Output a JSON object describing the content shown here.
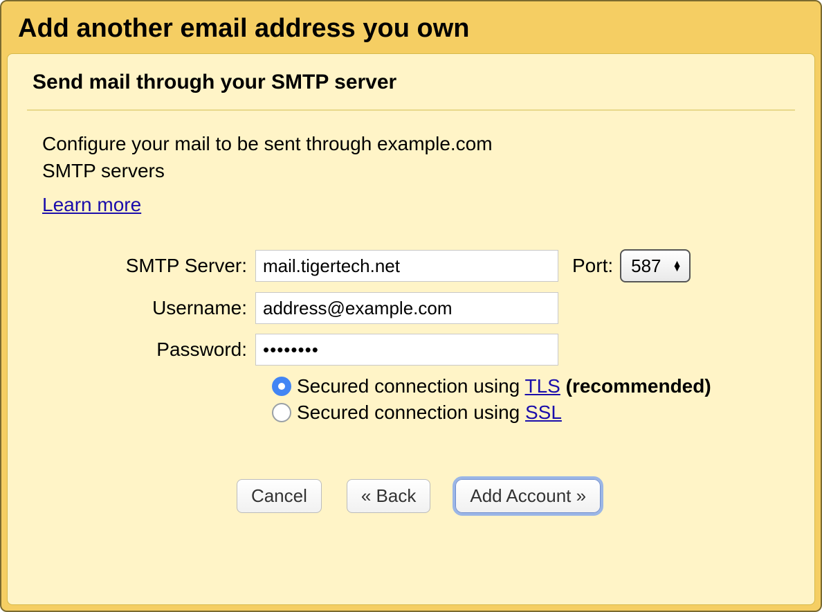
{
  "titlebar": {
    "title": "Add another email address you own"
  },
  "panel": {
    "heading": "Send mail through your SMTP server",
    "intro_line1": "Configure your mail to be sent through example.com",
    "intro_line2": "SMTP servers",
    "learn_more": "Learn more"
  },
  "form": {
    "smtp_label": "SMTP Server:",
    "smtp_value": "mail.tigertech.net",
    "port_label": "Port:",
    "port_value": "587",
    "username_label": "Username:",
    "username_value": "address@example.com",
    "password_label": "Password:",
    "password_value": "••••••••"
  },
  "security": {
    "tls_prefix": "Secured connection using ",
    "tls_link": "TLS",
    "tls_suffix": " (recommended)",
    "ssl_prefix": "Secured connection using ",
    "ssl_link": "SSL",
    "selected": "tls"
  },
  "buttons": {
    "cancel": "Cancel",
    "back": "« Back",
    "add": "Add Account »"
  }
}
